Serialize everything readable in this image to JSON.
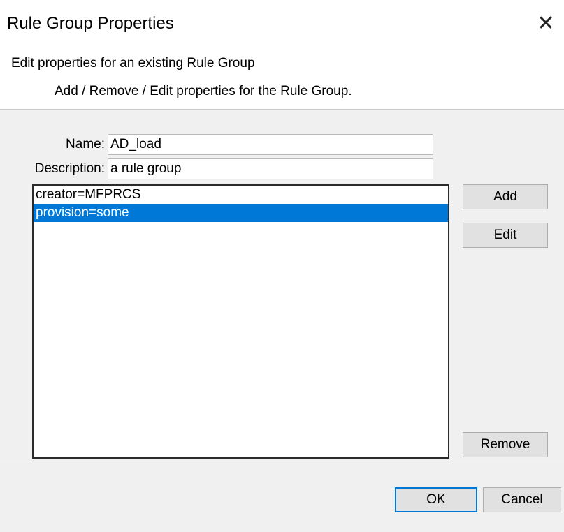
{
  "window": {
    "title": "Rule Group Properties",
    "close_glyph": "✕"
  },
  "header": {
    "title": "Edit properties for an existing Rule Group",
    "subtitle": "Add / Remove / Edit properties for the Rule Group."
  },
  "form": {
    "name_label": "Name:",
    "name_value": "AD_load",
    "description_label": "Description:",
    "description_value": "a rule group"
  },
  "properties": {
    "items": [
      {
        "text": "creator=MFPRCS",
        "selected": false
      },
      {
        "text": "provision=some",
        "selected": true
      }
    ]
  },
  "side_buttons": {
    "add": "Add",
    "edit": "Edit",
    "remove": "Remove"
  },
  "footer": {
    "ok": "OK",
    "cancel": "Cancel"
  },
  "colors": {
    "selection": "#0078d7",
    "default_button_border": "#0078d7",
    "dialog_bg": "#f0f0f0"
  }
}
